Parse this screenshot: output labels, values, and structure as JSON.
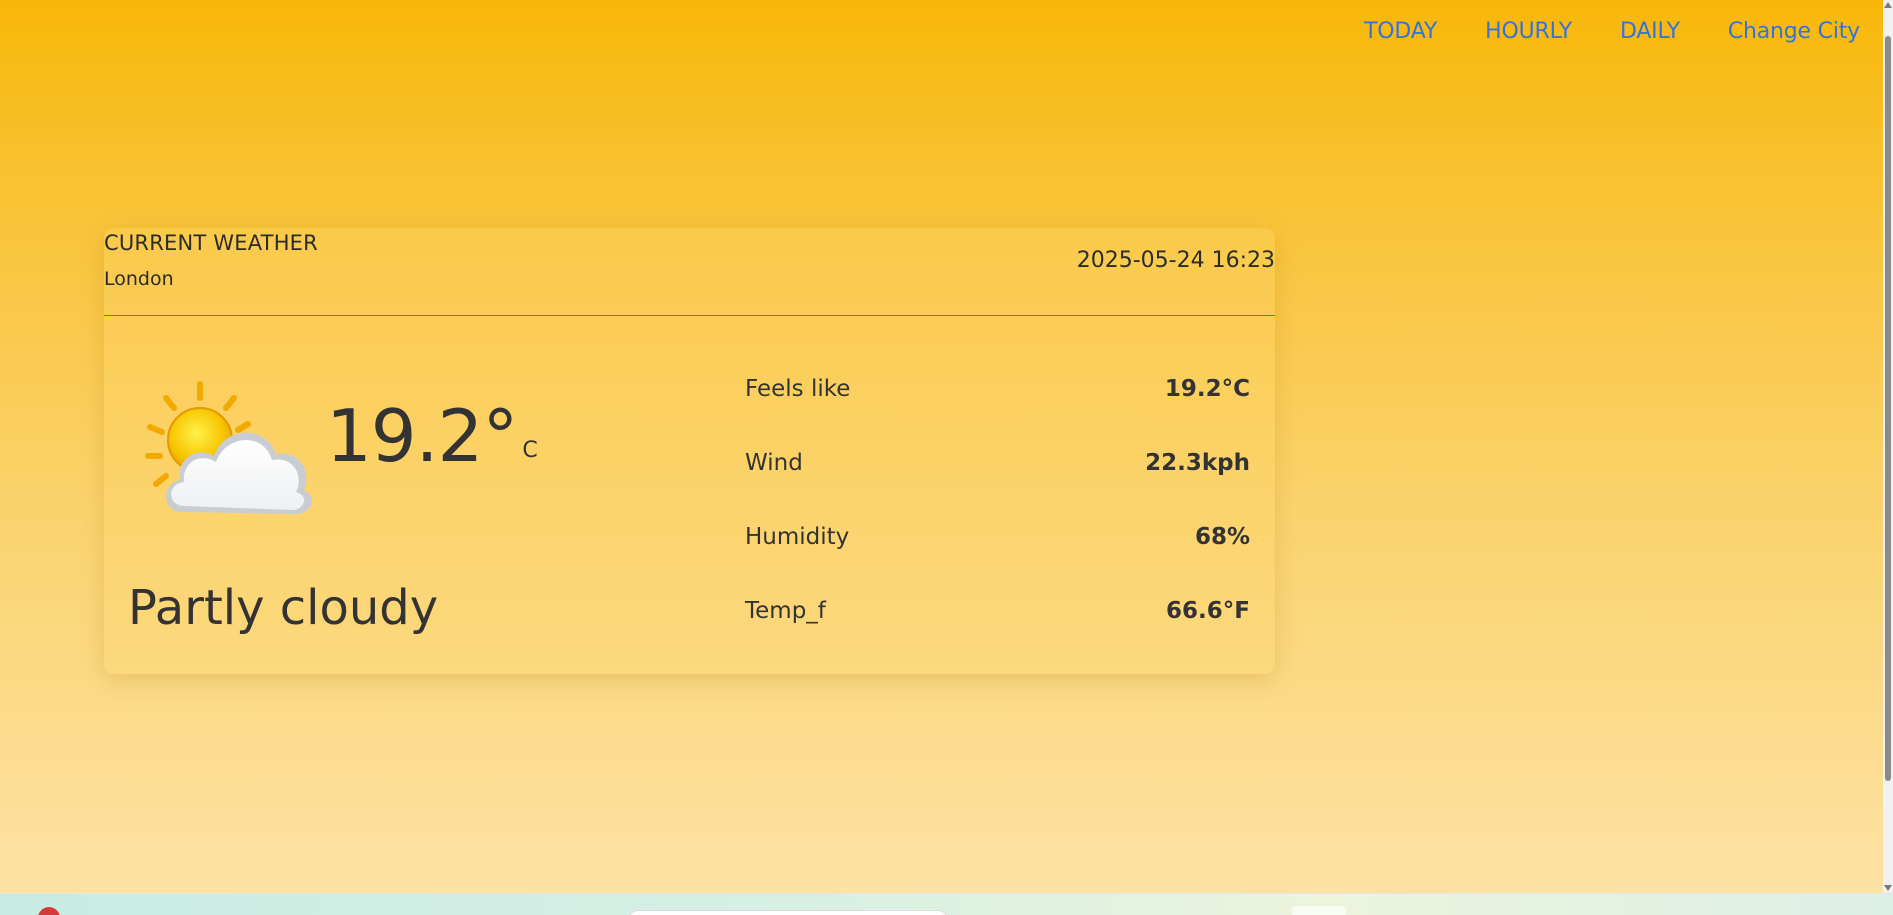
{
  "nav": {
    "items": [
      "TODAY",
      "HOURLY",
      "DAILY",
      "Change City"
    ]
  },
  "card": {
    "title": "CURRENT WEATHER",
    "city": "London",
    "datetime": "2025-05-24 16:23",
    "icon": "partly-cloudy-icon",
    "temperature": "19.2",
    "degree_symbol": "°",
    "unit": "C",
    "condition": "Partly cloudy",
    "details": [
      {
        "label": "Feels like",
        "value": "19.2°C"
      },
      {
        "label": "Wind",
        "value": "22.3kph"
      },
      {
        "label": "Humidity",
        "value": "68%"
      },
      {
        "label": "Temp_f",
        "value": "66.6°F"
      }
    ]
  },
  "colors": {
    "background_top": "#f8b709",
    "background_bottom": "#fce2a4",
    "nav_link": "#3474d8",
    "text": "#333333"
  }
}
